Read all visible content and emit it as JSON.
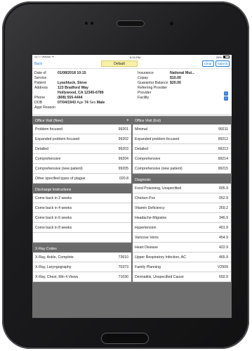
{
  "status_bar": {
    "carrier": "•••○○ Verizon ᯤ",
    "time": "6:34 PM",
    "battery": "29%"
  },
  "nav": {
    "back_label": "Back",
    "title": "Default",
    "clear_label": "Clear",
    "submit_label": "Submit"
  },
  "patient": {
    "date_of_service": {
      "label": "Date of Service",
      "value": "01/08/2018 10:15"
    },
    "patient": {
      "label": "Patient",
      "value": "Lyashluck, Steve"
    },
    "address": {
      "label": "Address",
      "line1": "123 Bradford Way",
      "line2": "Hollywood, CA 12345-6789"
    },
    "phone": {
      "label": "Phone",
      "value": "(808) 555-4444"
    },
    "dob": {
      "label": "DOB",
      "value": "07/04/1943",
      "age_label": "Age",
      "age": "74",
      "sex_label": "Sex",
      "sex": "Male"
    },
    "appt_reason": {
      "label": "Appt Reason",
      "value": ""
    },
    "insurance": {
      "label": "Insurance",
      "value": "National Mut..."
    },
    "copay": {
      "label": "Copay",
      "value": "$10.00"
    },
    "guarantor_balance": {
      "label": "Guarantor Balance",
      "value": "$20.00"
    },
    "referring_provider": {
      "label": "Referring Provider",
      "value": ""
    },
    "provider": {
      "label": "Provider",
      "value": ""
    },
    "facility": {
      "label": "Facility",
      "value": ""
    }
  },
  "office_visit_new": {
    "title": "Office Visit (New)",
    "plus": "+",
    "rows": [
      {
        "name": "Problem focused",
        "code": "99201"
      },
      {
        "name": "Expanded problem focused",
        "code": "99202"
      },
      {
        "name": "Detailed",
        "code": "99203"
      },
      {
        "name": "Comprehensive",
        "code": "99204"
      },
      {
        "name": "Comprehensive (new patient)",
        "code": "99205"
      },
      {
        "name": "Other specified types of plague",
        "code": "020.8"
      }
    ]
  },
  "discharge": {
    "title": "Discharge Instructions",
    "rows": [
      {
        "name": "Come back in 2 weeks"
      },
      {
        "name": "Come back in 4 weeks"
      },
      {
        "name": "Come back in 6 weeks"
      },
      {
        "name": "Come back in 8 weeks"
      }
    ]
  },
  "xray": {
    "title": "X-Ray Codes",
    "rows": [
      {
        "name": "X-Ray, Ankle, Complete",
        "code": "73610"
      },
      {
        "name": "X-Ray, Laryngography",
        "code": "70373"
      },
      {
        "name": "X-Ray, Chest, Min 4 Views",
        "code": "71030"
      }
    ]
  },
  "office_visit_est": {
    "title": "Office Visit (Est)",
    "rows": [
      {
        "name": "Minimal",
        "code": "99211"
      },
      {
        "name": "Expanded problem focused",
        "code": "99212"
      },
      {
        "name": "Detailed",
        "code": "99213"
      },
      {
        "name": "Comprehensive",
        "code": "99214"
      },
      {
        "name": "Comprehensive (new patient)",
        "code": "99215"
      }
    ]
  },
  "diagnosis": {
    "title": "Diagnosis",
    "rows": [
      {
        "name": "Food Poisoning, Unspecified",
        "code": "005.9"
      },
      {
        "name": "Chicken Pox",
        "code": "052.9"
      },
      {
        "name": "Vitamin Deficiency",
        "code": "269.2"
      },
      {
        "name": "Headache-Migraine",
        "code": "346.9"
      },
      {
        "name": "Hypertension",
        "code": "401.9"
      },
      {
        "name": "Varicose Veins",
        "code": "454.9"
      },
      {
        "name": "Heart Disease",
        "code": "422.9"
      },
      {
        "name": "Upper Respiratory Infection, AC",
        "code": "465.9"
      },
      {
        "name": "Family Planning",
        "code": "V2509"
      },
      {
        "name": "Dermatitis, Unspecified Cause",
        "code": "692.9"
      }
    ]
  },
  "colors": {
    "accent": "#1a7ad8",
    "default_chip": "#f7f0a6",
    "panel_header": "#6a6a6a",
    "device": "#1c1c1e"
  },
  "icons": {
    "arrow_button": "chevron-right-icon",
    "add": "plus-icon"
  }
}
